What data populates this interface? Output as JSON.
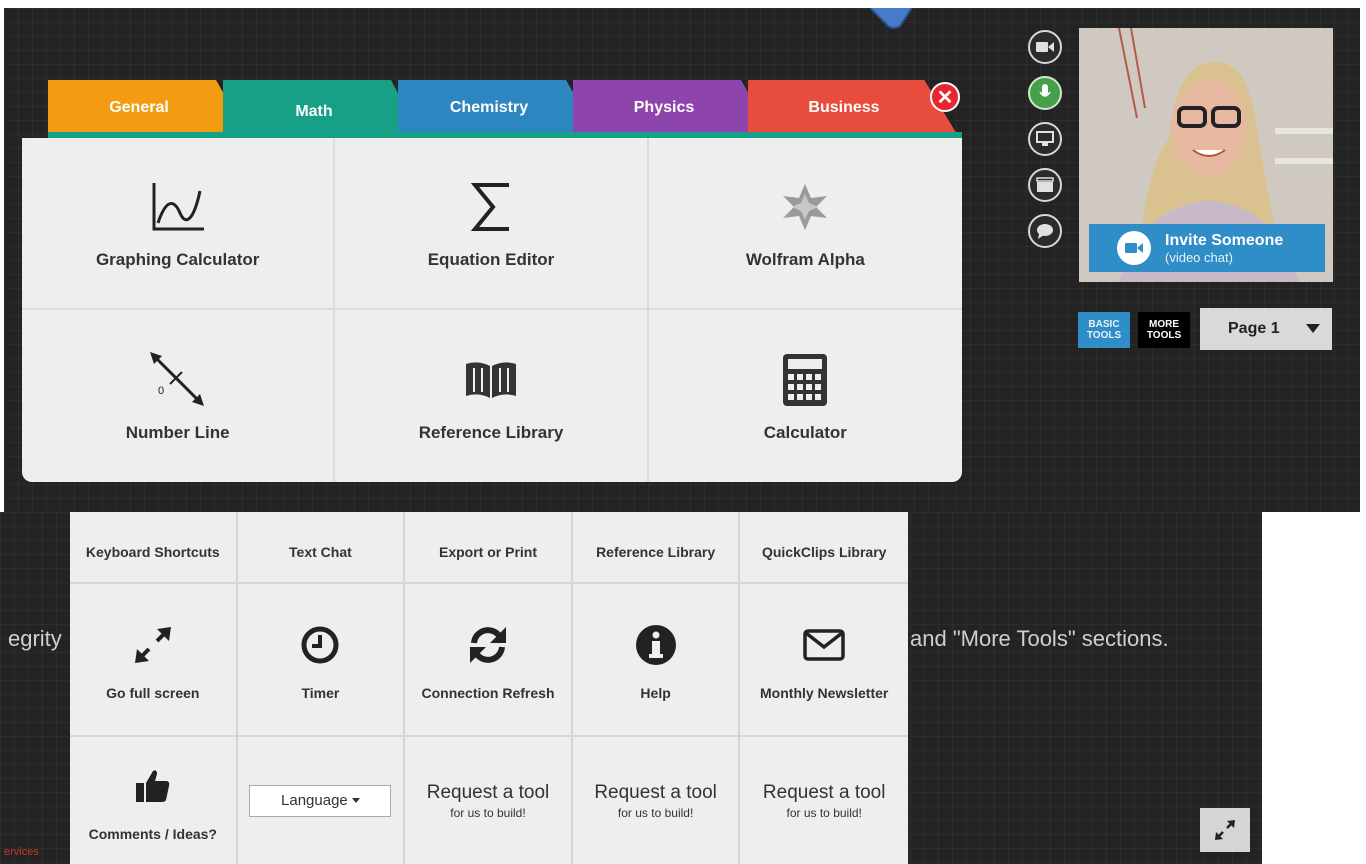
{
  "tools_panel": {
    "tabs": [
      {
        "label": "General",
        "color": "#f39c12"
      },
      {
        "label": "Math",
        "color": "#16a085"
      },
      {
        "label": "Chemistry",
        "color": "#2e86c1"
      },
      {
        "label": "Physics",
        "color": "#8e44ad"
      },
      {
        "label": "Business",
        "color": "#e74c3c"
      }
    ],
    "active_tab": "Math",
    "close_label": "✕",
    "tools": [
      {
        "label": "Graphing Calculator",
        "icon": "graph-icon"
      },
      {
        "label": "Equation Editor",
        "icon": "sigma-icon"
      },
      {
        "label": "Wolfram Alpha",
        "icon": "wolfram-star-icon"
      },
      {
        "label": "Number Line",
        "icon": "number-line-icon"
      },
      {
        "label": "Reference Library",
        "icon": "book-icon"
      },
      {
        "label": "Calculator",
        "icon": "calculator-icon"
      }
    ],
    "number_line_zero": "0"
  },
  "video": {
    "side_icons": [
      "video-camera-icon",
      "microphone-icon",
      "screen-share-icon",
      "clapperboard-icon",
      "chat-bubble-icon"
    ],
    "invite_title": "Invite Someone",
    "invite_subtitle": "(video chat)"
  },
  "toolbar": {
    "basic_tools": "BASIC\nTOOLS",
    "more_tools": "MORE\nTOOLS",
    "page_select": "Page 1"
  },
  "background_text": {
    "left": "egrity",
    "right": "and \"More Tools\" sections.",
    "services": "ervices"
  },
  "more_tools_grid": {
    "row1": [
      "Keyboard Shortcuts",
      "Text Chat",
      "Export or Print",
      "Reference Library",
      "QuickClips Library"
    ],
    "row2": [
      {
        "label": "Go full screen",
        "icon": "fullscreen-icon"
      },
      {
        "label": "Timer",
        "icon": "clock-icon"
      },
      {
        "label": "Connection Refresh",
        "icon": "refresh-icon"
      },
      {
        "label": "Help",
        "icon": "info-icon"
      },
      {
        "label": "Monthly Newsletter",
        "icon": "envelope-icon"
      }
    ],
    "comments_label": "Comments / Ideas?",
    "language_label": "Language",
    "request_title": "Request a tool",
    "request_subtitle": "for us to build!"
  },
  "colors": {
    "canvas_bg": "#232323",
    "accent_blue": "#2f8dc7",
    "close_red": "#e8262f",
    "mic_green": "#45a049"
  }
}
